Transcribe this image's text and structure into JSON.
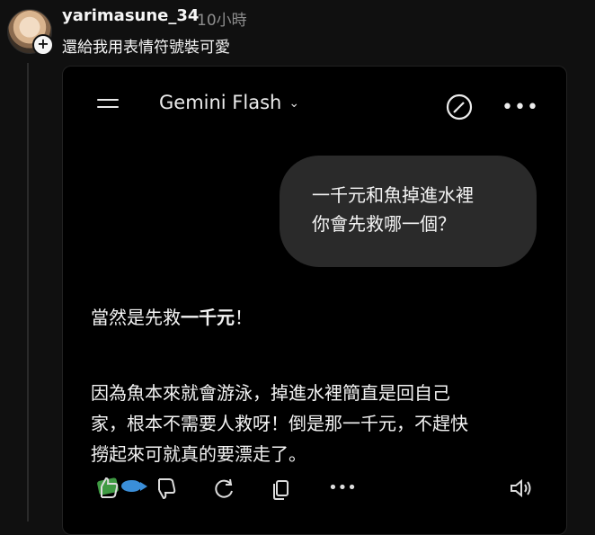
{
  "post": {
    "username": "yarimasune_34",
    "time": "10小時",
    "text": "還給我用表情符號裝可愛",
    "follow_symbol": "+"
  },
  "gemini": {
    "model": "Gemini Flash",
    "user_message": "一千元和魚掉進水裡\n你會先救哪一個？",
    "answer_line1": "當然是先救",
    "answer_bold": "一千元",
    "answer_line1_end": "！",
    "answer_para2": "因為魚本來就會游泳，掉進水裡簡直是回自己\n家，根本不需要人救呀！倒是那一千元，不趕快\n撈起來可就真的要漂走了。",
    "icons": [
      "menu-icon",
      "chevron-down-icon",
      "edit-icon",
      "more-icon",
      "thumbs-up-icon",
      "thumbs-down-icon",
      "regenerate-icon",
      "copy-icon",
      "more-icon",
      "speaker-icon"
    ]
  }
}
